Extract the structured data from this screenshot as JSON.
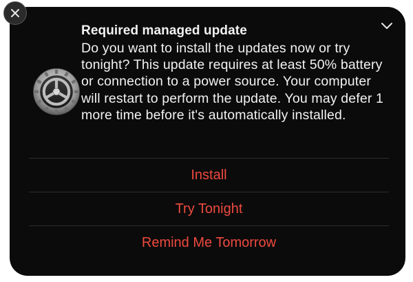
{
  "notification": {
    "title": "Required managed update",
    "body": "Do you want to install the updates now or try tonight? This update requires at least 50% battery or connection to a power source. Your computer will restart to perform the update. You may defer 1 more time before it's automatically installed.",
    "icon": "system-preferences-gear-icon",
    "actions": [
      {
        "label": "Install"
      },
      {
        "label": "Try Tonight"
      },
      {
        "label": "Remind Me Tomorrow"
      }
    ]
  },
  "colors": {
    "background": "#0b0b0b",
    "text": "#f2f2f2",
    "action": "#ee4a3f",
    "divider": "#2f2f2f"
  }
}
